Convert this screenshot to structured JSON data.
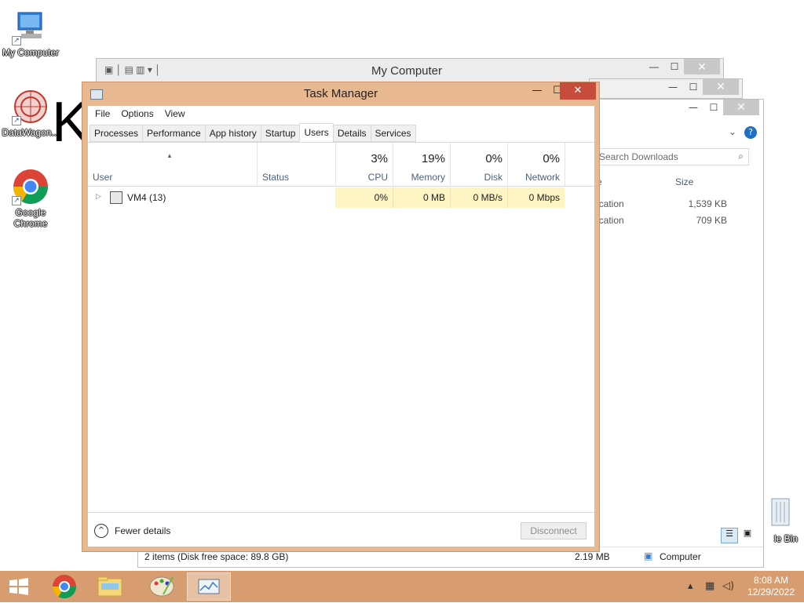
{
  "desktop": {
    "icons": [
      {
        "label": "My Computer"
      },
      {
        "label": "DataWagon..."
      },
      {
        "label": "Google Chrome"
      },
      {
        "label": "le Bin"
      }
    ],
    "big_letter": "K"
  },
  "explorer_back": {
    "title": "My Computer"
  },
  "explorer_front": {
    "search_placeholder": "Search Downloads",
    "col_size": "Size",
    "col_type_partial": "e",
    "rows": [
      {
        "type": "ication",
        "size": "1,539 KB"
      },
      {
        "type": "ication",
        "size": "709 KB"
      }
    ],
    "status_items": "2 items (Disk free space: 89.8 GB)",
    "status_size": "2.19 MB",
    "status_location": "Computer"
  },
  "task_manager": {
    "title": "Task Manager",
    "menu": [
      "File",
      "Options",
      "View"
    ],
    "tabs": [
      "Processes",
      "Performance",
      "App history",
      "Startup",
      "Users",
      "Details",
      "Services"
    ],
    "active_tab": "Users",
    "columns": {
      "user": "User",
      "status": "Status",
      "cpu": {
        "pct": "3%",
        "name": "CPU"
      },
      "memory": {
        "pct": "19%",
        "name": "Memory"
      },
      "disk": {
        "pct": "0%",
        "name": "Disk"
      },
      "network": {
        "pct": "0%",
        "name": "Network"
      }
    },
    "rows": [
      {
        "user": "VM4 (13)",
        "status": "",
        "cpu": "0%",
        "memory": "0 MB",
        "disk": "0 MB/s",
        "network": "0 Mbps"
      }
    ],
    "fewer_details": "Fewer details",
    "disconnect": "Disconnect"
  },
  "taskbar": {
    "time": "8:08 AM",
    "date": "12/29/2022"
  },
  "colors": {
    "taskbar": "#d79d71",
    "tm_frame": "#e8b890",
    "heat": "#fff4c4",
    "close_red": "#c74c3c"
  }
}
